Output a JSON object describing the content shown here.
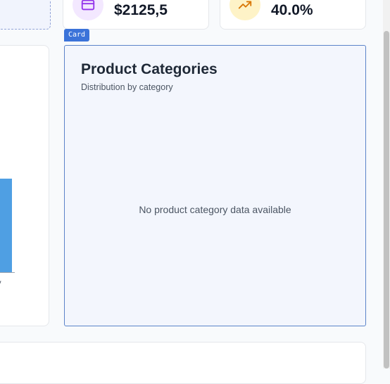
{
  "stats": [
    {
      "value": "$2125,5",
      "icon": "credit-card-icon",
      "color": "#9333ea"
    },
    {
      "value": "40.0%",
      "icon": "trending-up-icon",
      "color": "#d97706"
    }
  ],
  "left_chart": {
    "tick_label": "ay",
    "bar_color": "#4f9fe3"
  },
  "categories_card": {
    "tag": "Card",
    "title": "Product Categories",
    "subtitle": "Distribution by category",
    "empty_message": "No product category data available"
  }
}
